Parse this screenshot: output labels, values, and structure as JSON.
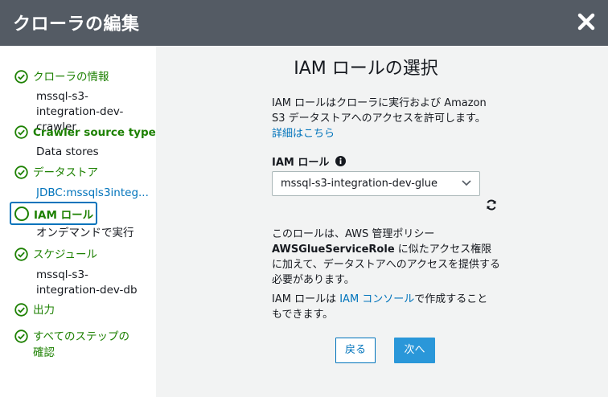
{
  "window": {
    "title": "クローラの編集"
  },
  "sidebar": {
    "steps": [
      {
        "label": "クローラの情報",
        "value": "mssql-s3-integration-dev-crawler"
      },
      {
        "label": "Crawler source type",
        "value": "Data stores"
      },
      {
        "label": "データストア",
        "value": "JDBC:mssqls3integ..."
      },
      {
        "label": "IAM ロール",
        "value": "オンデマンドで実行"
      },
      {
        "label": "スケジュール",
        "value": "mssql-s3-integration-dev-db"
      },
      {
        "label": "出力"
      },
      {
        "label": "すべてのステップの確認"
      }
    ]
  },
  "main": {
    "heading": "IAM ロールの選択",
    "desc": "IAM ロールはクローラに実行および Amazon S3 データストアへのアクセスを許可します。",
    "details_link": "詳細はこちら",
    "field_label": "IAM ロール",
    "selected_role": "mssql-s3-integration-dev-glue",
    "para2_pre": "このロールは、AWS 管理ポリシー",
    "para2_bold": "AWSGlueServiceRole",
    "para2_post": " に似たアクセス権限に加えて、データストアへのアクセスを提供する必要があります。",
    "para3_pre": "IAM ロールは ",
    "para3_link": "IAM コンソール",
    "para3_post": "で作成することもできます。",
    "back_label": "戻る",
    "next_label": "次へ"
  },
  "colors": {
    "header": "#545b64",
    "success": "#1d8102",
    "link": "#0073bb",
    "primary": "#2a97d9"
  }
}
